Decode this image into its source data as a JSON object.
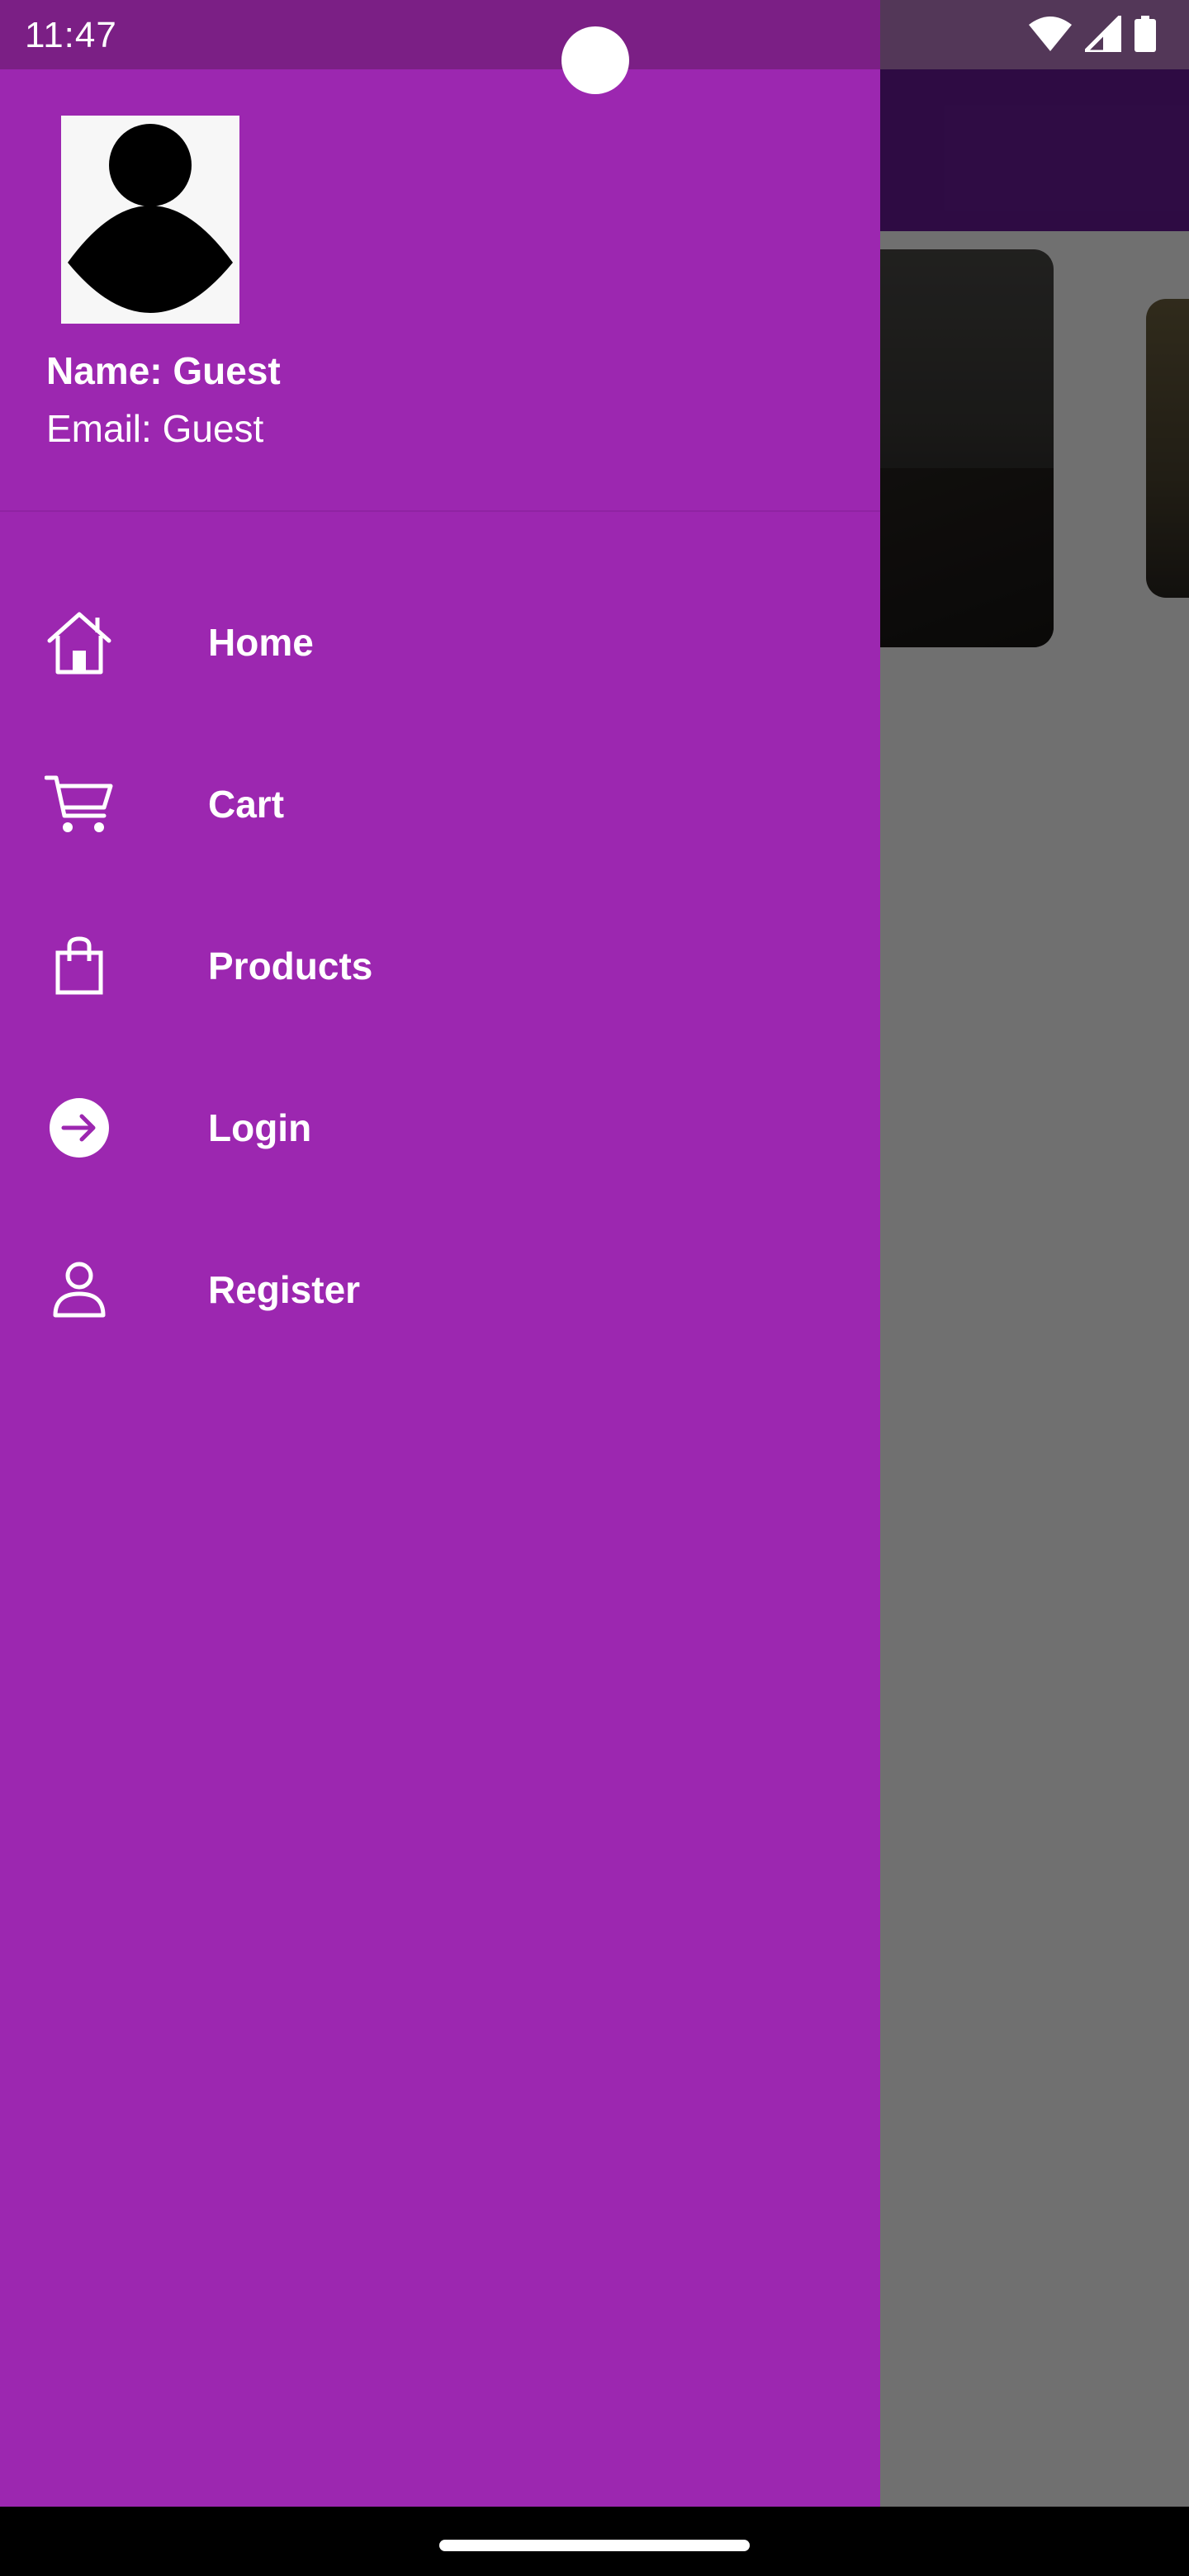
{
  "status_bar": {
    "time": "11:47",
    "icons": [
      "wifi-icon",
      "signal-icon",
      "battery-icon"
    ]
  },
  "drawer": {
    "header": {
      "avatar_icon": "person-icon",
      "name": "Name: Guest",
      "email": "Email: Guest"
    },
    "items": [
      {
        "label": "Home",
        "icon": "home-icon"
      },
      {
        "label": "Cart",
        "icon": "cart-icon"
      },
      {
        "label": "Products",
        "icon": "shopping-bag-icon"
      },
      {
        "label": "Login",
        "icon": "login-arrow-icon"
      },
      {
        "label": "Register",
        "icon": "person-outline-icon"
      }
    ]
  },
  "colors": {
    "drawer_background": "#9c27b0",
    "app_bar": "#6a1b9a",
    "text": "#ffffff"
  }
}
